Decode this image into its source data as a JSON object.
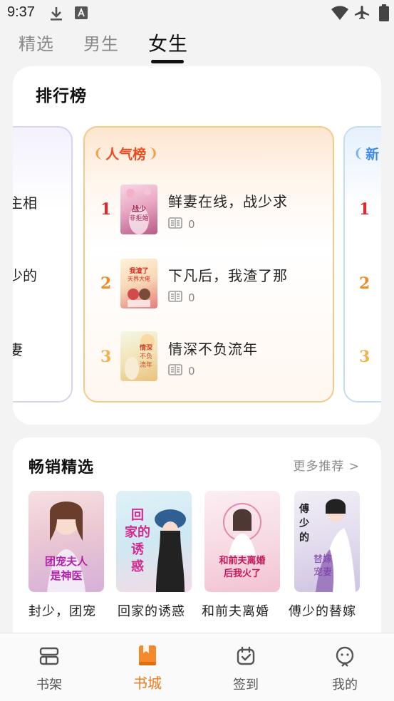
{
  "status_bar": {
    "time": "9:37",
    "icons": [
      "download-icon",
      "text-a-icon",
      "wifi-icon",
      "airplane-icon",
      "battery-icon"
    ]
  },
  "top_tabs": [
    {
      "label": "精选",
      "active": false
    },
    {
      "label": "男生",
      "active": false
    },
    {
      "label": "女生",
      "active": true
    }
  ],
  "ranking": {
    "title": "排行榜",
    "main_panel": {
      "badge": "人气榜",
      "items": [
        {
          "rank": "1",
          "title": "鲜妻在线，战少求",
          "reads": "0",
          "cover_text": "战少\n非拒婚"
        },
        {
          "rank": "2",
          "title": "下凡后，我渣了那",
          "reads": "0",
          "cover_text": "我渣了那个\n天界大佬"
        },
        {
          "rank": "3",
          "title": "情深不负流年",
          "reads": "0",
          "cover_text": "情深不负\n流年"
        }
      ]
    },
    "left_panel": {
      "items": [
        {
          "title_tail": "主相"
        },
        {
          "title_tail": "少的"
        },
        {
          "title_tail": "妻"
        }
      ]
    },
    "right_panel": {
      "badge": "新",
      "ranks": [
        "1",
        "2",
        "3"
      ]
    }
  },
  "bestseller": {
    "title": "畅销精选",
    "more_label": "更多推荐 >",
    "books": [
      {
        "title": "封少，团宠",
        "cover_text": "团宠夫人\n是神医"
      },
      {
        "title": "回家的诱惑",
        "cover_text": "回家\n的诱惑"
      },
      {
        "title": "和前夫离婚",
        "cover_text": "和前夫离婚\n后我火了"
      },
      {
        "title": "傅少的替嫁",
        "cover_text": "傅少的\n替嫁宠妻"
      }
    ]
  },
  "bottom_nav": [
    {
      "label": "书架",
      "icon": "bookshelf-icon",
      "active": false
    },
    {
      "label": "书城",
      "icon": "bookstore-icon",
      "active": true
    },
    {
      "label": "签到",
      "icon": "checkin-icon",
      "active": false
    },
    {
      "label": "我的",
      "icon": "profile-icon",
      "active": false
    }
  ],
  "colors": {
    "accent": "#f07a1c",
    "rank1": "#e2262a",
    "rank2": "#f08a24",
    "rank3": "#f3b14a",
    "badge_red": "#ef4a1e",
    "badge_blue": "#3d8ae6"
  }
}
